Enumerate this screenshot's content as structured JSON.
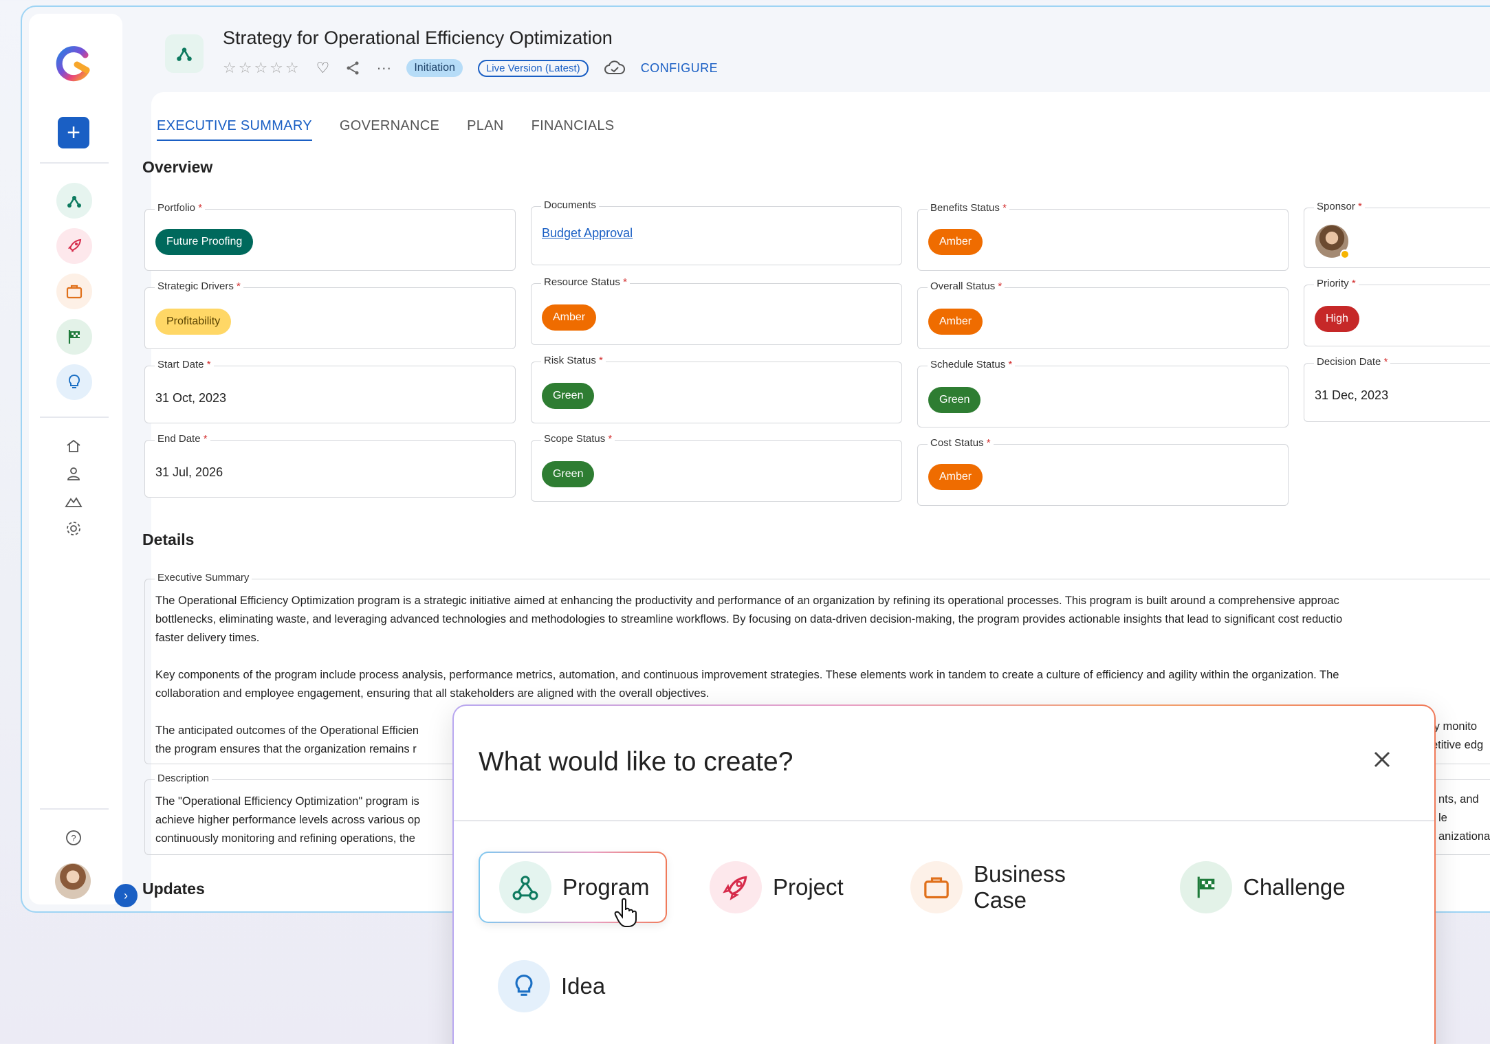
{
  "header": {
    "title": "Strategy for Operational Efficiency Optimization",
    "stars": "☆☆☆☆☆",
    "stage_badge": "Initiation",
    "version_badge": "Live Version (Latest)",
    "configure": "CONFIGURE"
  },
  "tabs": [
    "EXECUTIVE SUMMARY",
    "GOVERNANCE",
    "PLAN",
    "FINANCIALS"
  ],
  "overview": {
    "heading": "Overview",
    "portfolio": {
      "label": "Portfolio",
      "value": "Future Proofing"
    },
    "strategic_drivers": {
      "label": "Strategic Drivers",
      "value": "Profitability"
    },
    "start_date": {
      "label": "Start Date",
      "value": "31 Oct, 2023"
    },
    "end_date": {
      "label": "End Date",
      "value": "31 Jul, 2026"
    },
    "documents": {
      "label": "Documents",
      "value": "Budget Approval"
    },
    "resource_status": {
      "label": "Resource Status",
      "value": "Amber"
    },
    "risk_status": {
      "label": "Risk Status",
      "value": "Green"
    },
    "scope_status": {
      "label": "Scope Status",
      "value": "Green"
    },
    "benefits_status": {
      "label": "Benefits Status",
      "value": "Amber"
    },
    "overall_status": {
      "label": "Overall Status",
      "value": "Amber"
    },
    "schedule_status": {
      "label": "Schedule Status",
      "value": "Green"
    },
    "cost_status": {
      "label": "Cost Status",
      "value": "Amber"
    },
    "sponsor": {
      "label": "Sponsor"
    },
    "priority": {
      "label": "Priority",
      "value": "High"
    },
    "decision_date": {
      "label": "Decision Date",
      "value": "31 Dec, 2023"
    },
    "required_mark": "*"
  },
  "details": {
    "heading": "Details",
    "executive_summary_label": "Executive Summary",
    "executive_summary_text": "The Operational Efficiency Optimization program is a strategic initiative aimed at enhancing the productivity and performance of an organization by refining its operational processes. This program is built around a comprehensive approac\nbottlenecks, eliminating waste, and leveraging advanced technologies and methodologies to streamline workflows. By focusing on data-driven decision-making, the program provides actionable insights that lead to significant cost reductio\nfaster delivery times.\n\nKey components of the program include process analysis, performance metrics, automation, and continuous improvement strategies. These elements work in tandem to create a culture of efficiency and agility within the organization. The\ncollaboration and employee engagement, ensuring that all stakeholders are aligned with the overall objectives.\n\nThe anticipated outcomes of the Operational Efficien\nthe program ensures that the organization remains r",
    "executive_summary_tail": "ly monito\netitive edg",
    "description_label": "Description",
    "description_text": "The \"Operational Efficiency Optimization\" program is\nachieve higher performance levels across various op\ncontinuously monitoring and refining operations, the",
    "description_tail": "nts, and le\nanizationa"
  },
  "updates": {
    "heading": "Updates"
  },
  "modal": {
    "title": "What would like to create?",
    "options": [
      {
        "label": "Program",
        "icon": "program-icon",
        "selected": true
      },
      {
        "label": "Project",
        "icon": "rocket-icon"
      },
      {
        "label": "Business Case",
        "icon": "briefcase-icon"
      },
      {
        "label": "Challenge",
        "icon": "checkered-flag-icon"
      },
      {
        "label": "Idea",
        "icon": "lightbulb-icon"
      }
    ]
  },
  "colors": {
    "accent": "#1a5fc4",
    "green": "#2e7d32",
    "amber": "#ef6c00",
    "red": "#c62828",
    "teal": "#00695c"
  }
}
